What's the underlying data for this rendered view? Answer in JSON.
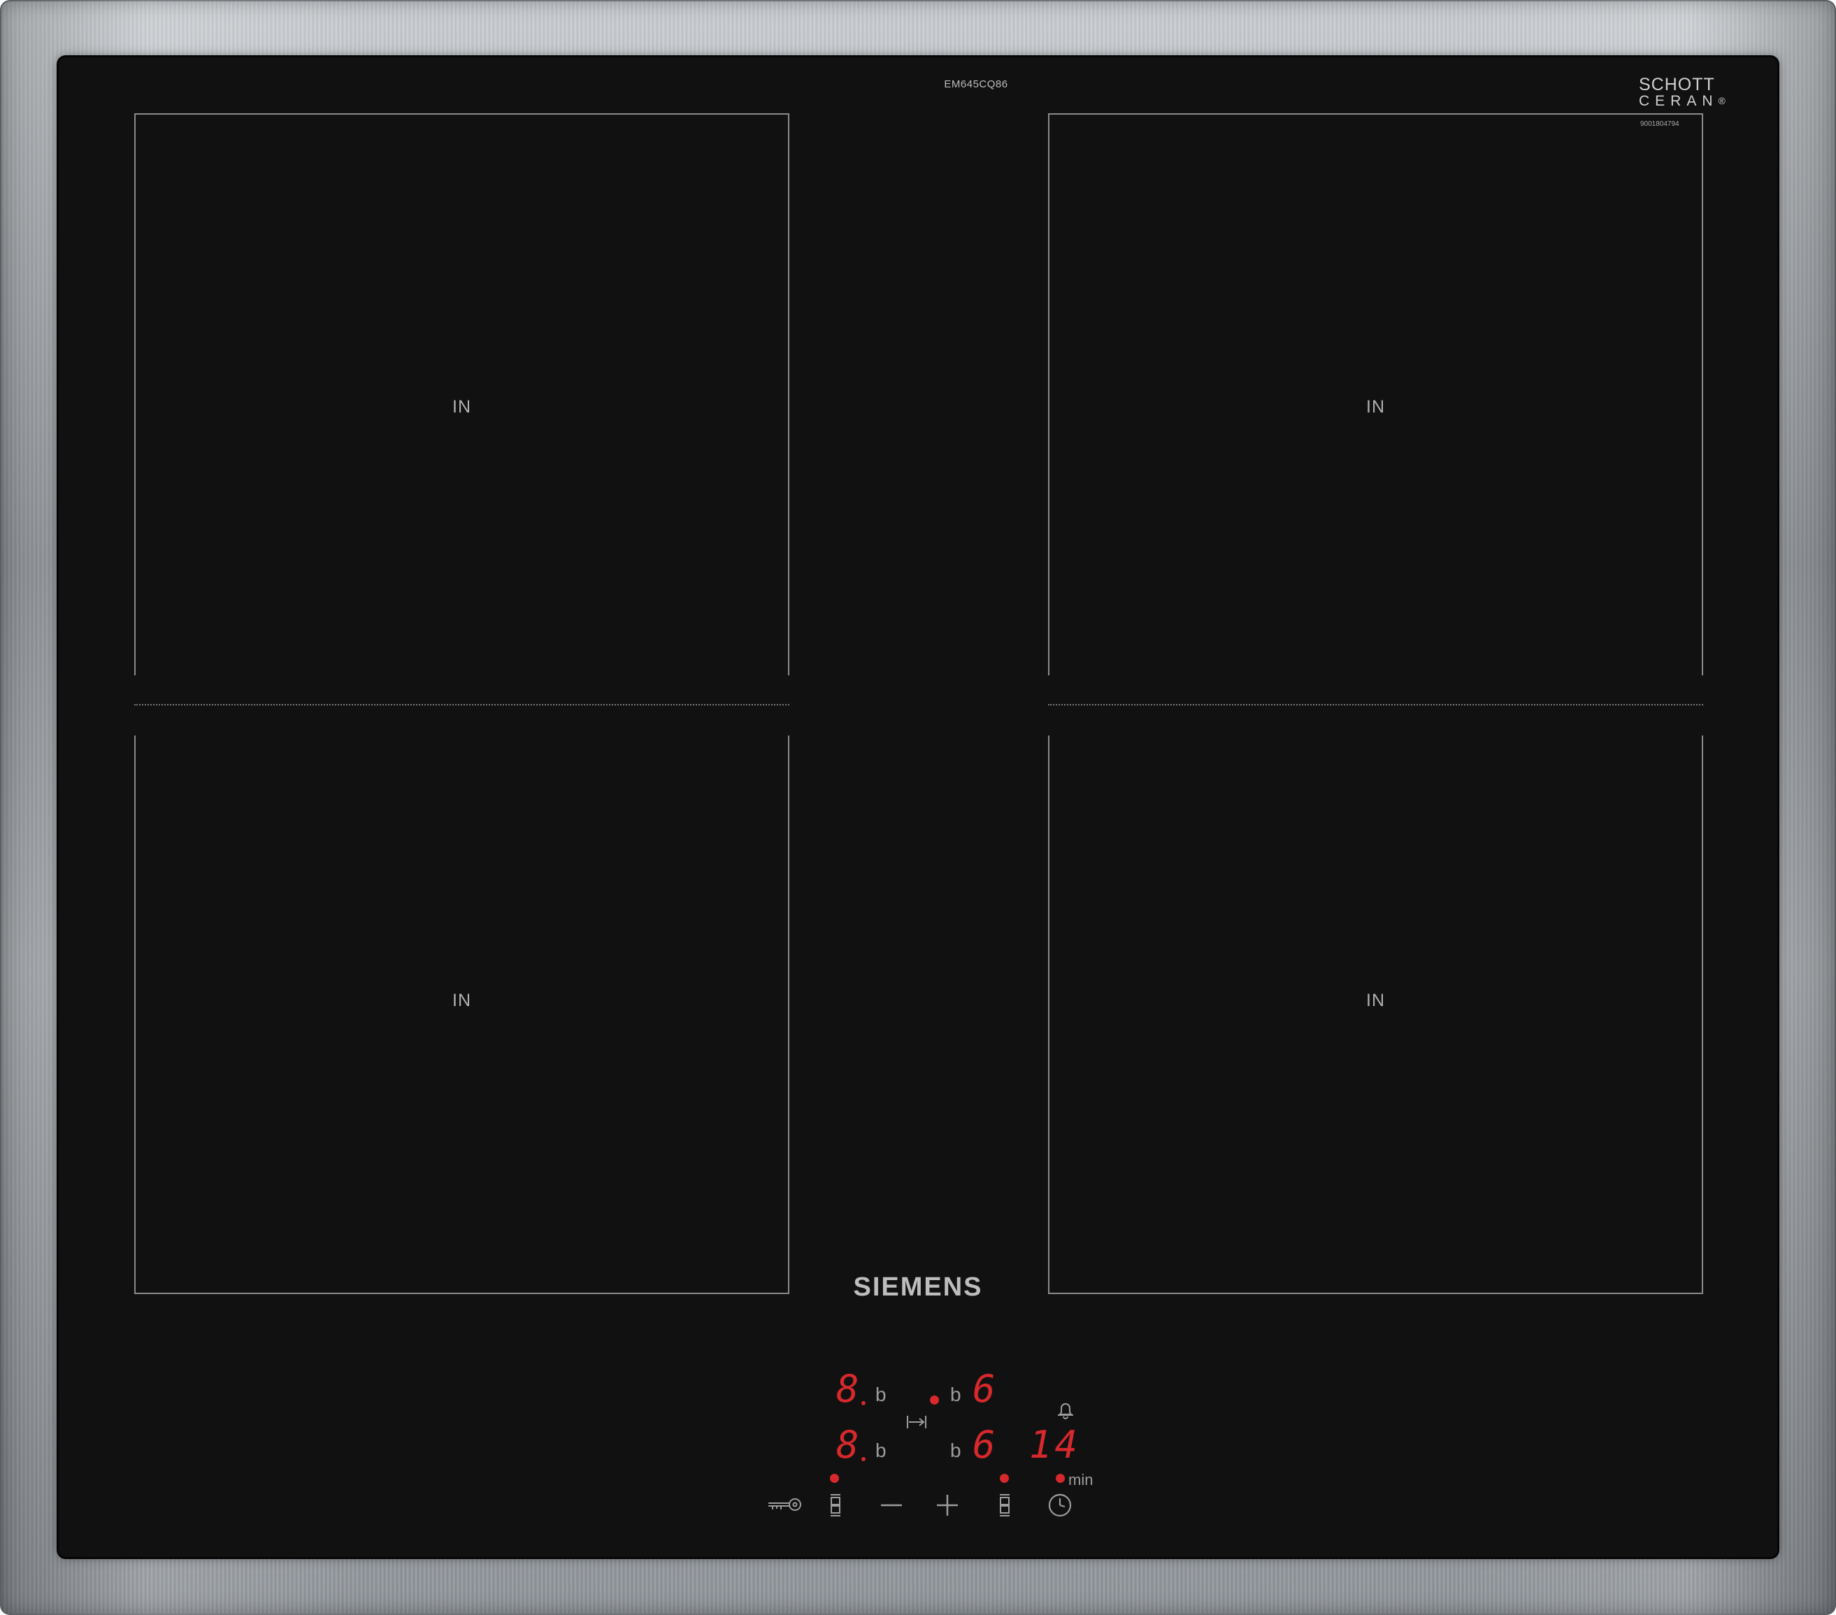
{
  "device": {
    "model_code": "EM645CQ86",
    "brand": "SIEMENS",
    "glass_brand_line1": "SCHOTT",
    "glass_brand_line2": "CERAN",
    "glass_brand_mark": "®",
    "serial": "9001804794"
  },
  "zones": [
    {
      "label": "IN"
    },
    {
      "label": "IN"
    },
    {
      "label": "IN"
    },
    {
      "label": "IN"
    }
  ],
  "displays": {
    "front_left_level": "8",
    "rear_left_level": "8",
    "rear_left_mode": "b",
    "front_left_mode": "b",
    "rear_right_mode": "b",
    "front_right_mode": "b",
    "rear_right_level": "6",
    "front_right_level": "6",
    "timer_value": "14",
    "timer_unit": "min"
  },
  "controls": {
    "lock_icon": "key-icon",
    "left_zone_select_icon": "zone-select-icon",
    "minus_icon": "minus-icon",
    "plus_icon": "plus-icon",
    "right_zone_select_icon": "zone-select-icon",
    "timer_icon": "clock-icon",
    "bridge_icon": "flex-zone-icon",
    "alarm_icon": "bell-icon"
  },
  "colors": {
    "glass": "#111111",
    "display_red": "#d7282c",
    "zone_outline": "#8a8a8a"
  }
}
